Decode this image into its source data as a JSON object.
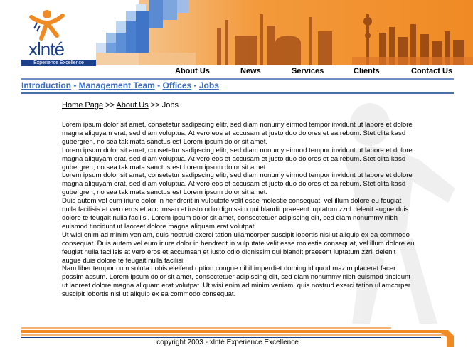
{
  "logo": {
    "wordmark": "xlnté",
    "tagline": "Experience Excellence"
  },
  "nav": {
    "items": [
      "About Us",
      "News",
      "Services",
      "Clients",
      "Contact Us"
    ]
  },
  "subnav": {
    "links": [
      "Introduction",
      "Management Team",
      "Offices",
      "Jobs"
    ],
    "separator": "-"
  },
  "breadcrumb": {
    "home": "Home Page",
    "about": "About Us",
    "separator": ">>",
    "current": "Jobs"
  },
  "content": {
    "paragraphs": [
      "Lorem ipsum dolor sit amet, consetetur sadipscing elitr, sed diam nonumy eirmod tempor invidunt ut labore et dolore magna aliquyam erat, sed diam voluptua. At vero eos et accusam et justo duo dolores et ea rebum. Stet clita kasd gubergren, no sea takimata sanctus est Lorem ipsum dolor sit amet.",
      "Lorem ipsum dolor sit amet, consetetur sadipscing elitr, sed diam nonumy eirmod tempor invidunt ut labore et dolore magna aliquyam erat, sed diam voluptua. At vero eos et accusam et justo duo dolores et ea rebum. Stet clita kasd gubergren, no sea takimata sanctus est Lorem ipsum dolor sit amet.",
      "Lorem ipsum dolor sit amet, consetetur sadipscing elitr, sed diam nonumy eirmod tempor invidunt ut labore et dolore magna aliquyam erat, sed diam voluptua. At vero eos et accusam et justo duo dolores et ea rebum. Stet clita kasd gubergren, no sea takimata sanctus est Lorem ipsum dolor sit amet.",
      "Duis autem vel eum iriure dolor in hendrerit in vulputate velit esse molestie consequat, vel illum dolore eu feugiat nulla facilisis at vero eros et accumsan et iusto odio dignissim qui blandit praesent luptatum zzril delenit augue duis dolore te feugait nulla facilisi. Lorem ipsum dolor sit amet, consectetuer adipiscing elit, sed diam nonummy nibh euismod tincidunt ut laoreet dolore magna aliquam erat volutpat.",
      "Ut wisi enim ad minim veniam, quis nostrud exerci tation ullamcorper suscipit lobortis nisl ut aliquip ex ea commodo consequat. Duis autem vel eum iriure dolor in hendrerit in vulputate velit esse molestie consequat, vel illum dolore eu feugiat nulla facilisis at vero eros et accumsan et iusto odio dignissim qui blandit praesent luptatum zzril delenit augue duis dolore te feugait nulla facilisi.",
      "Nam liber tempor cum soluta nobis eleifend option congue nihil imperdiet doming id quod mazim placerat facer possim assum. Lorem ipsum dolor sit amet, consectetuer adipiscing elit, sed diam nonummy nibh euismod tincidunt ut laoreet dolore magna aliquam erat volutpat. Ut wisi enim ad minim veniam, quis nostrud exerci tation ullamcorper suscipit lobortis nisl ut aliquip ex ea commodo consequat."
    ]
  },
  "footer": {
    "copyright": "copyright 2003 - xlnté Experience Excellence"
  },
  "colors": {
    "brand_blue": "#1b3f8a",
    "brand_orange": "#f08a24",
    "link_blue": "#3b6fc4",
    "stripe_light": "#f5b371"
  }
}
